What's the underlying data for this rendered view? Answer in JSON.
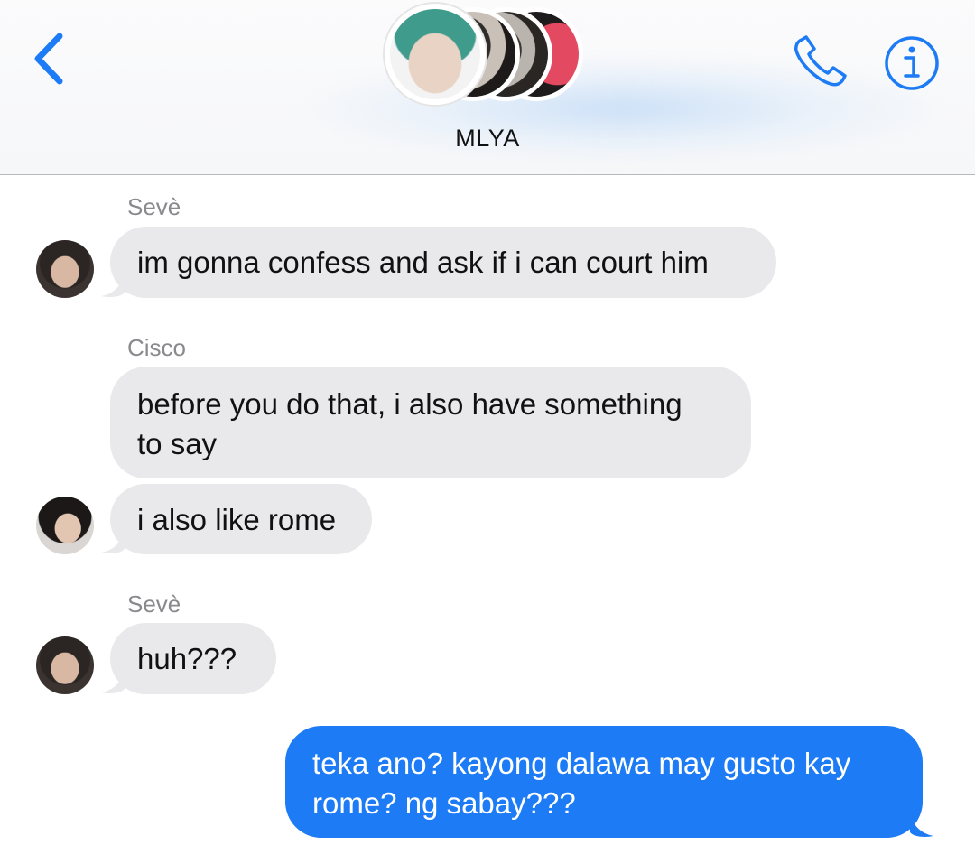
{
  "header": {
    "title": "MLYA",
    "back_icon": "chevron-left-icon",
    "call_icon": "phone-icon",
    "info_icon": "info-icon",
    "accent_color": "#1c7bf5"
  },
  "messages": [
    {
      "sender": "Sevè",
      "direction": "incoming",
      "text": "im gonna confess and ask if i can court him"
    },
    {
      "sender": "Cisco",
      "direction": "incoming",
      "text_line1": "before you do that, i also have something",
      "text_line2": "to say"
    },
    {
      "direction": "incoming",
      "text": "i also like rome"
    },
    {
      "sender": "Sevè",
      "direction": "incoming",
      "text": "huh???"
    },
    {
      "direction": "outgoing",
      "text_line1": "teka ano? kayong dalawa may gusto kay",
      "text_line2": "rome? ng sabay???"
    }
  ],
  "colors": {
    "incoming_bubble": "#e9e9eb",
    "outgoing_bubble": "#1c7bf5",
    "sender_label": "#8a8a8e"
  }
}
